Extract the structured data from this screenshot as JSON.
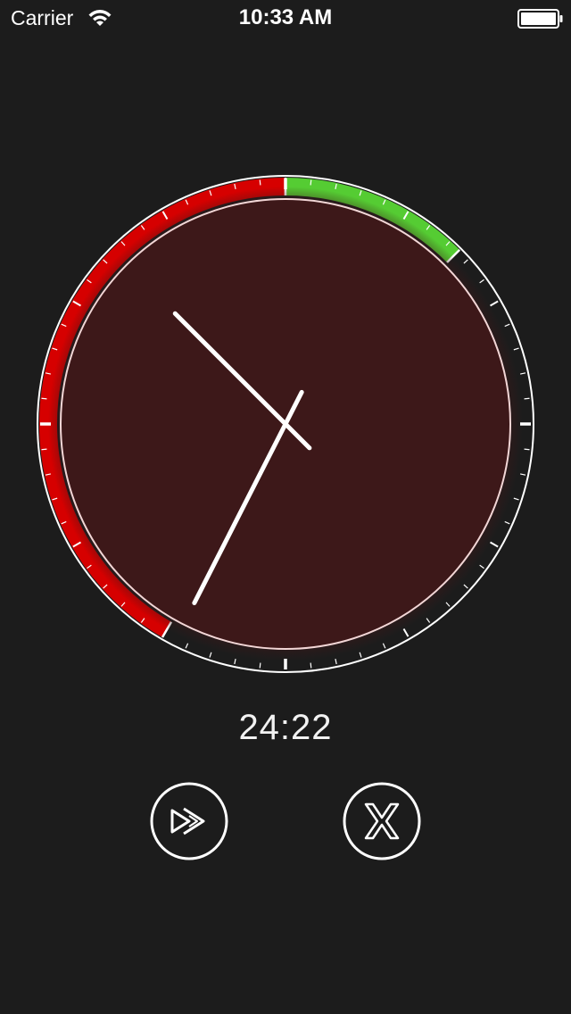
{
  "status_bar": {
    "carrier": "Carrier",
    "time": "10:33 AM",
    "icons": [
      "wifi-icon",
      "battery-icon"
    ]
  },
  "clock": {
    "minutes_elapsed": 24,
    "seconds_elapsed": 22,
    "segments": [
      {
        "name": "overtime",
        "from_minute": 35,
        "to_minute": 60,
        "color": "#d60000"
      },
      {
        "name": "on_time",
        "from_minute": 0,
        "to_minute": 7.5,
        "color": "#55cc33"
      }
    ],
    "face_color": "#3d1819",
    "hour_hand_minute_pos": 52.5,
    "minute_hand_minute_pos": 34.5
  },
  "timer": {
    "display": "24:22"
  },
  "controls": {
    "skip_icon": "fast-forward-icon",
    "cancel_icon": "close-x-icon"
  },
  "colors": {
    "background": "#1c1c1c",
    "accent_red": "#d60000",
    "accent_green": "#55cc33",
    "foreground": "#ffffff"
  }
}
